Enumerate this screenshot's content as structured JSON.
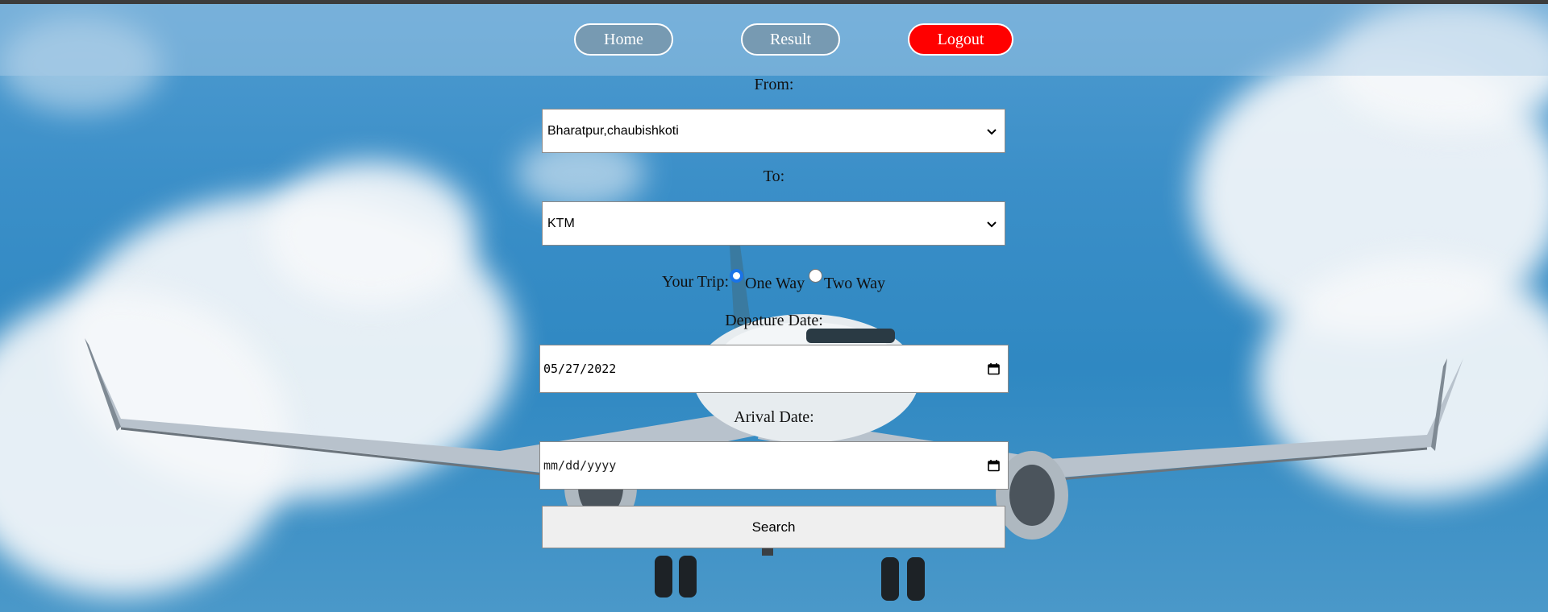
{
  "nav": {
    "home_label": "Home",
    "result_label": "Result",
    "logout_label": "Logout"
  },
  "form": {
    "from_label": "From:",
    "from_value": "Bharatpur,chaubishkoti",
    "to_label": "To:",
    "to_value": "KTM",
    "trip_label": "Your Trip:",
    "trip_options": [
      "One Way",
      "Two Way"
    ],
    "trip_selected": "One Way",
    "departure_label": "Depature Date:",
    "departure_value": "05/27/2022",
    "arrival_label": "Arival Date:",
    "arrival_placeholder": "mm/dd/yyyy",
    "search_label": "Search"
  },
  "icons": {
    "dropdown": "chevron-down-icon",
    "calendar": "calendar-icon"
  },
  "colors": {
    "logout_bg": "#ff0000",
    "nav_bg": "#7896aa",
    "radio_accent": "#1a73e8"
  }
}
